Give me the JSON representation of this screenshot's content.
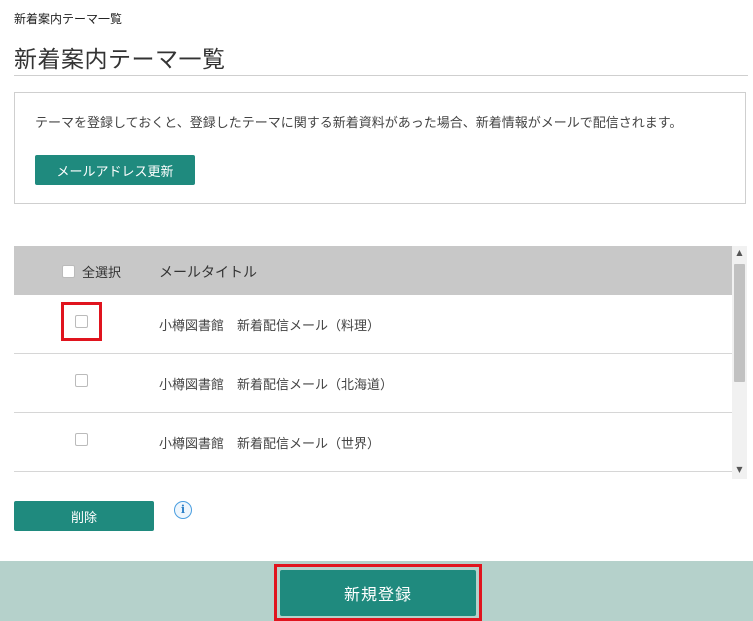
{
  "breadcrumb": "新着案内テーマ一覧",
  "page_title": "新着案内テーマ一覧",
  "info": {
    "text": "テーマを登録しておくと、登録したテーマに関する新着資料があった場合、新着情報がメールで配信されます。",
    "email_button": "メールアドレス更新"
  },
  "table": {
    "select_all_label": "全選択",
    "column_title": "メールタイトル",
    "rows": [
      {
        "title": "小樽図書館　新着配信メール（料理）"
      },
      {
        "title": "小樽図書館　新着配信メール（北海道）"
      },
      {
        "title": "小樽図書館　新着配信メール（世界）"
      }
    ]
  },
  "actions": {
    "delete_label": "削除",
    "info_icon": "i",
    "register_label": "新規登録"
  },
  "colors": {
    "accent": "#1f8a7e",
    "footer_bg": "#b5d1cb",
    "highlight": "#e0141e",
    "header_bg": "#c8c8c8"
  }
}
